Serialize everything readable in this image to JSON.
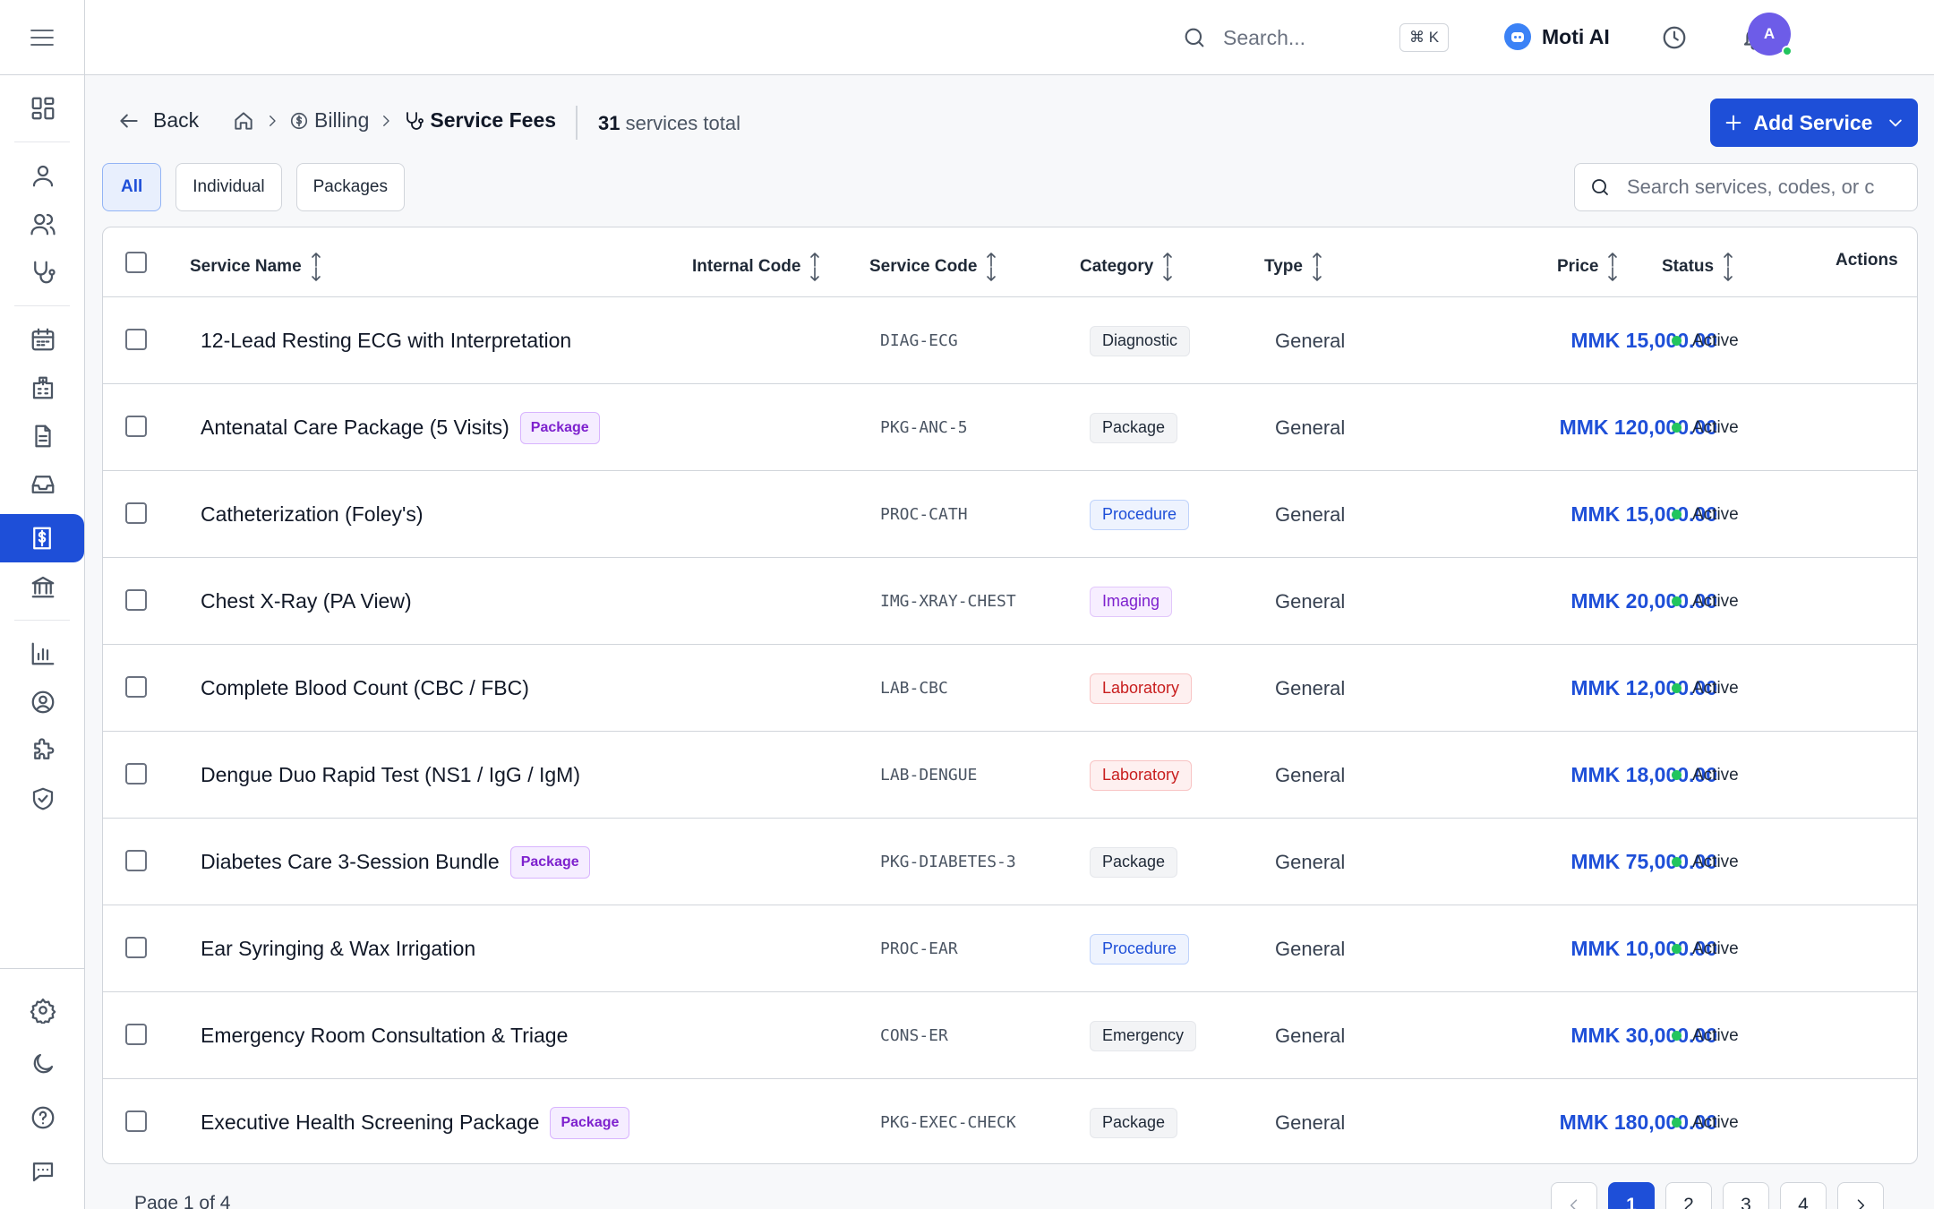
{
  "colors": {
    "accent": "#1e4fd8",
    "status_active": "#22c55e"
  },
  "topbar": {
    "search_placeholder": "Search...",
    "shortcut": "⌘ K",
    "assistant_label": "Moti AI",
    "avatar_initial": "A"
  },
  "header": {
    "back_label": "Back",
    "breadcrumb": {
      "billing": "Billing",
      "current": "Service Fees"
    },
    "total_count": "31",
    "total_suffix": "services total",
    "add_button": "Add Service"
  },
  "filters": {
    "tabs": [
      {
        "label": "All",
        "active": true
      },
      {
        "label": "Individual",
        "active": false
      },
      {
        "label": "Packages",
        "active": false
      }
    ],
    "search_placeholder": "Search services, codes, or c"
  },
  "table": {
    "columns": {
      "service_name": "Service Name",
      "internal_code": "Internal Code",
      "service_code": "Service Code",
      "category": "Category",
      "type": "Type",
      "price": "Price",
      "status": "Status",
      "actions": "Actions"
    },
    "package_badge": "Package",
    "rows": [
      {
        "name": "12-Lead Resting ECG with Interpretation",
        "is_package": false,
        "service_code": "DIAG-ECG",
        "category": "Diagnostic",
        "type": "General",
        "price": "MMK 15,000.00",
        "status": "Active"
      },
      {
        "name": "Antenatal Care Package (5 Visits)",
        "is_package": true,
        "service_code": "PKG-ANC-5",
        "category": "Package",
        "type": "General",
        "price": "MMK 120,000.00",
        "status": "Active"
      },
      {
        "name": "Catheterization (Foley's)",
        "is_package": false,
        "service_code": "PROC-CATH",
        "category": "Procedure",
        "type": "General",
        "price": "MMK 15,000.00",
        "status": "Active"
      },
      {
        "name": "Chest X-Ray (PA View)",
        "is_package": false,
        "service_code": "IMG-XRAY-CHEST",
        "category": "Imaging",
        "type": "General",
        "price": "MMK 20,000.00",
        "status": "Active"
      },
      {
        "name": "Complete Blood Count (CBC / FBC)",
        "is_package": false,
        "service_code": "LAB-CBC",
        "category": "Laboratory",
        "type": "General",
        "price": "MMK 12,000.00",
        "status": "Active"
      },
      {
        "name": "Dengue Duo Rapid Test (NS1 / IgG / IgM)",
        "is_package": false,
        "service_code": "LAB-DENGUE",
        "category": "Laboratory",
        "type": "General",
        "price": "MMK 18,000.00",
        "status": "Active"
      },
      {
        "name": "Diabetes Care 3-Session Bundle",
        "is_package": true,
        "service_code": "PKG-DIABETES-3",
        "category": "Package",
        "type": "General",
        "price": "MMK 75,000.00",
        "status": "Active"
      },
      {
        "name": "Ear Syringing & Wax Irrigation",
        "is_package": false,
        "service_code": "PROC-EAR",
        "category": "Procedure",
        "type": "General",
        "price": "MMK 10,000.00",
        "status": "Active"
      },
      {
        "name": "Emergency Room Consultation & Triage",
        "is_package": false,
        "service_code": "CONS-ER",
        "category": "Emergency",
        "type": "General",
        "price": "MMK 30,000.00",
        "status": "Active"
      },
      {
        "name": "Executive Health Screening Package",
        "is_package": true,
        "service_code": "PKG-EXEC-CHECK",
        "category": "Package",
        "type": "General",
        "price": "MMK 180,000.00",
        "status": "Active"
      }
    ]
  },
  "category_styles": {
    "Diagnostic": {
      "bg": "#f3f4f6",
      "border": "#e5e7eb",
      "color": "#1f2937"
    },
    "Package": {
      "bg": "#f3f4f6",
      "border": "#e5e7eb",
      "color": "#1f2937"
    },
    "Emergency": {
      "bg": "#f3f4f6",
      "border": "#e5e7eb",
      "color": "#1f2937"
    },
    "Procedure": {
      "bg": "#eef3fe",
      "border": "#bfd3fb",
      "color": "#1e4fd8"
    },
    "Imaging": {
      "bg": "#f7eeff",
      "border": "#e2c7fb",
      "color": "#7e22ce"
    },
    "Laboratory": {
      "bg": "#fef0f0",
      "border": "#f8c4c4",
      "color": "#c81e1e"
    }
  },
  "pagination": {
    "info": "Page 1 of 4",
    "pages": [
      "1",
      "2",
      "3",
      "4"
    ],
    "current": "1"
  }
}
